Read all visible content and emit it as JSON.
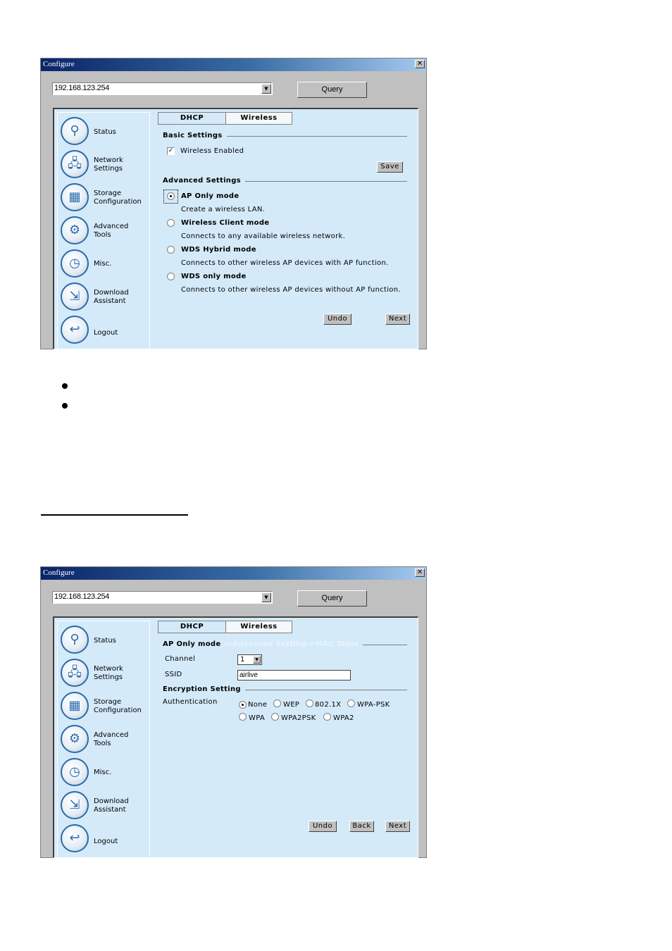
{
  "window1": {
    "title": "Configure",
    "address_value": "192.168.123.254",
    "query_label": "Query",
    "sidebar": [
      {
        "icon": "magnifier-icon",
        "label": "Status"
      },
      {
        "icon": "network-icon",
        "label": "Network\nSettings"
      },
      {
        "icon": "storage-grid-icon",
        "label": "Storage\nConfiguration"
      },
      {
        "icon": "gears-icon",
        "label": "Advanced\nTools"
      },
      {
        "icon": "clock-icon",
        "label": "Misc."
      },
      {
        "icon": "download-icon",
        "label": "Download\nAssistant"
      },
      {
        "icon": "logout-arrow-icon",
        "label": "Logout"
      }
    ],
    "tabs": [
      {
        "label": "DHCP",
        "active": false
      },
      {
        "label": "Wireless",
        "active": true
      }
    ],
    "basic_settings": {
      "heading": "Basic Settings",
      "wireless_enabled_label": "Wireless Enabled",
      "wireless_enabled_checked": true,
      "save_label": "Save"
    },
    "advanced_settings": {
      "heading": "Advanced Settings",
      "modes": [
        {
          "label": "AP Only mode",
          "desc": "Create a wireless LAN.",
          "selected": true
        },
        {
          "label": "Wireless Client mode",
          "desc": "Connects to any available wireless network.",
          "selected": false
        },
        {
          "label": "WDS Hybrid mode",
          "desc": "Connects to other wireless AP devices with AP function.",
          "selected": false
        },
        {
          "label": "WDS only mode",
          "desc": "Connects to other wireless AP devices without AP function.",
          "selected": false
        }
      ]
    },
    "buttons": {
      "undo": "Undo",
      "next": "Next"
    }
  },
  "window2": {
    "title": "Configure",
    "address_value": "192.168.123.254",
    "query_label": "Query",
    "sidebar": [
      {
        "icon": "magnifier-icon",
        "label": "Status"
      },
      {
        "icon": "network-icon",
        "label": "Network\nSettings"
      },
      {
        "icon": "storage-grid-icon",
        "label": "Storage\nConfiguration"
      },
      {
        "icon": "gears-icon",
        "label": "Advanced\nTools"
      },
      {
        "icon": "clock-icon",
        "label": "Misc."
      },
      {
        "icon": "download-icon",
        "label": "Download\nAssistant"
      },
      {
        "icon": "logout-arrow-icon",
        "label": "Logout"
      }
    ],
    "tabs": [
      {
        "label": "DHCP",
        "active": false
      },
      {
        "label": "Wireless",
        "active": true
      }
    ],
    "ap_section": {
      "heading": "AP Only mode",
      "breadcrumb": " ->Advanced Setting->MAC Table",
      "channel_label": "Channel",
      "channel_value": "1",
      "ssid_label": "SSID",
      "ssid_value": "airlive"
    },
    "encryption": {
      "heading": "Encryption Setting",
      "auth_label": "Authentication",
      "options": [
        {
          "label": "None",
          "selected": true
        },
        {
          "label": "WEP",
          "selected": false
        },
        {
          "label": "802.1X",
          "selected": false
        },
        {
          "label": "WPA-PSK",
          "selected": false
        },
        {
          "label": "WPA",
          "selected": false
        },
        {
          "label": "WPA2PSK",
          "selected": false
        },
        {
          "label": "WPA2",
          "selected": false
        }
      ]
    },
    "buttons": {
      "undo": "Undo",
      "back": "Back",
      "next": "Next"
    }
  },
  "document": {
    "bullet_count": 2
  }
}
